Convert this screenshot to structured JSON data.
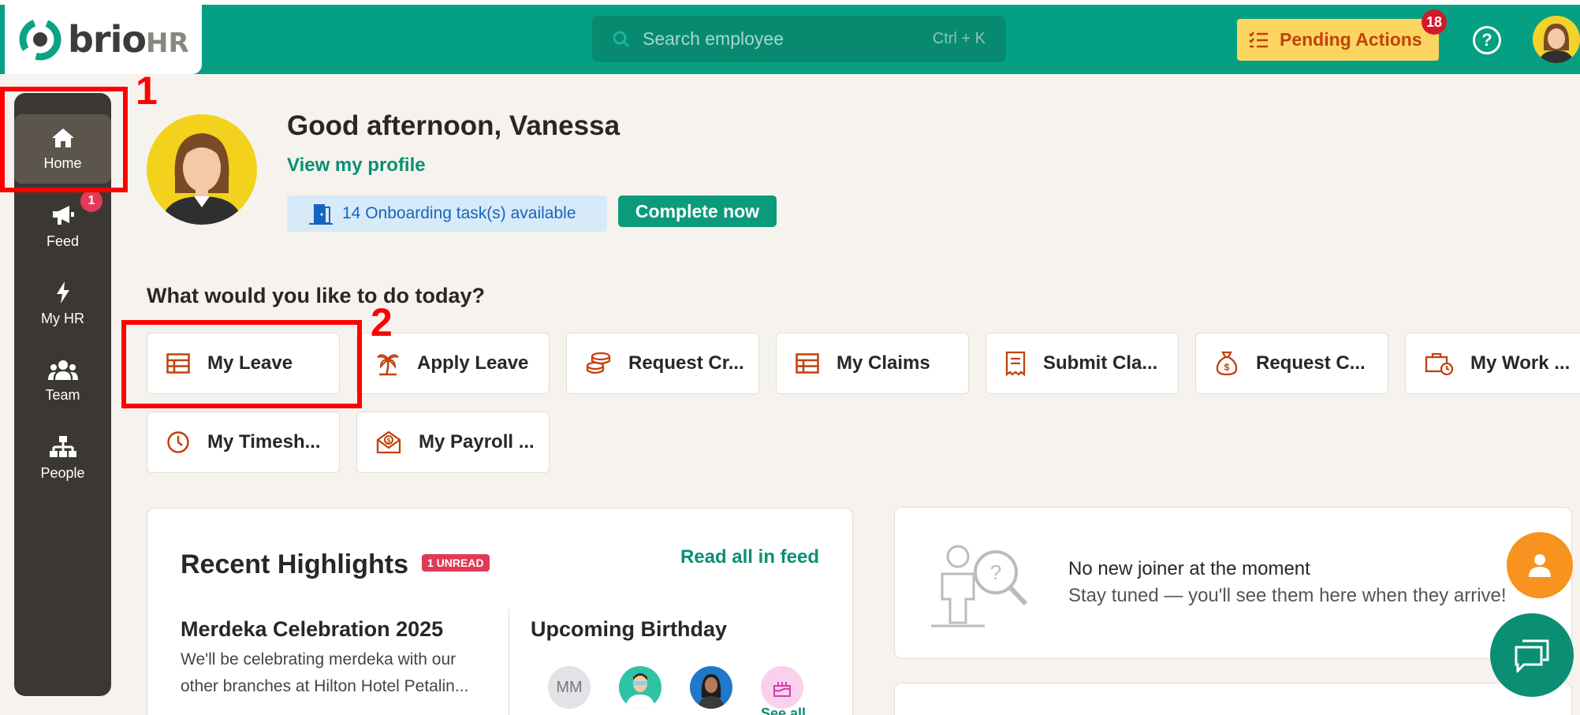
{
  "header": {
    "logo_brand": "brio",
    "logo_suffix": "HR",
    "search_placeholder": "Search employee",
    "search_shortcut": "Ctrl + K",
    "pending_label": "Pending Actions",
    "pending_count": "18"
  },
  "sidebar": {
    "items": [
      {
        "label": "Home",
        "icon": "home-icon",
        "active": true
      },
      {
        "label": "Feed",
        "icon": "megaphone-icon",
        "badge": "1"
      },
      {
        "label": "My HR",
        "icon": "lightning-icon"
      },
      {
        "label": "Team",
        "icon": "team-icon"
      },
      {
        "label": "People",
        "icon": "org-chart-icon"
      }
    ]
  },
  "annotations": {
    "one": "1",
    "two": "2"
  },
  "greeting": {
    "text": "Good afternoon, Vanessa",
    "profile_link": "View my profile",
    "onboarding": "14 Onboarding task(s) available",
    "complete_button": "Complete now"
  },
  "quick_actions": {
    "heading": "What would you like to do today?",
    "tiles": [
      {
        "label": "My Leave",
        "icon": "calendar-table-icon"
      },
      {
        "label": "Apply Leave",
        "icon": "palm-tree-icon"
      },
      {
        "label": "Request Cr...",
        "icon": "coins-icon"
      },
      {
        "label": "My Claims",
        "icon": "claims-table-icon"
      },
      {
        "label": "Submit Cla...",
        "icon": "receipt-icon"
      },
      {
        "label": "Request C...",
        "icon": "money-bag-icon"
      },
      {
        "label": "My Work ...",
        "icon": "briefcase-clock-icon"
      },
      {
        "label": "My Timesh...",
        "icon": "clock-icon"
      },
      {
        "label": "My Payroll ...",
        "icon": "payroll-envelope-icon"
      }
    ]
  },
  "highlights": {
    "title": "Recent Highlights",
    "unread": "1 UNREAD",
    "read_all": "Read all in feed",
    "news_title": "Merdeka Celebration 2025",
    "news_body": "We'll be celebrating merdeka with our other branches at Hilton Hotel Petalin...",
    "birthday_title": "Upcoming Birthday",
    "birthday_initials": "MM",
    "see_all": "See all"
  },
  "new_joiner": {
    "title": "No new joiner at the moment",
    "subtitle": "Stay tuned — you'll see them here when they arrive!"
  },
  "colors": {
    "brand_green": "#05a083",
    "pending_yellow": "#fcd561",
    "sidebar_dark": "#3b3833",
    "accent_orange": "#c2410c",
    "annotation_red": "#ff0000"
  }
}
